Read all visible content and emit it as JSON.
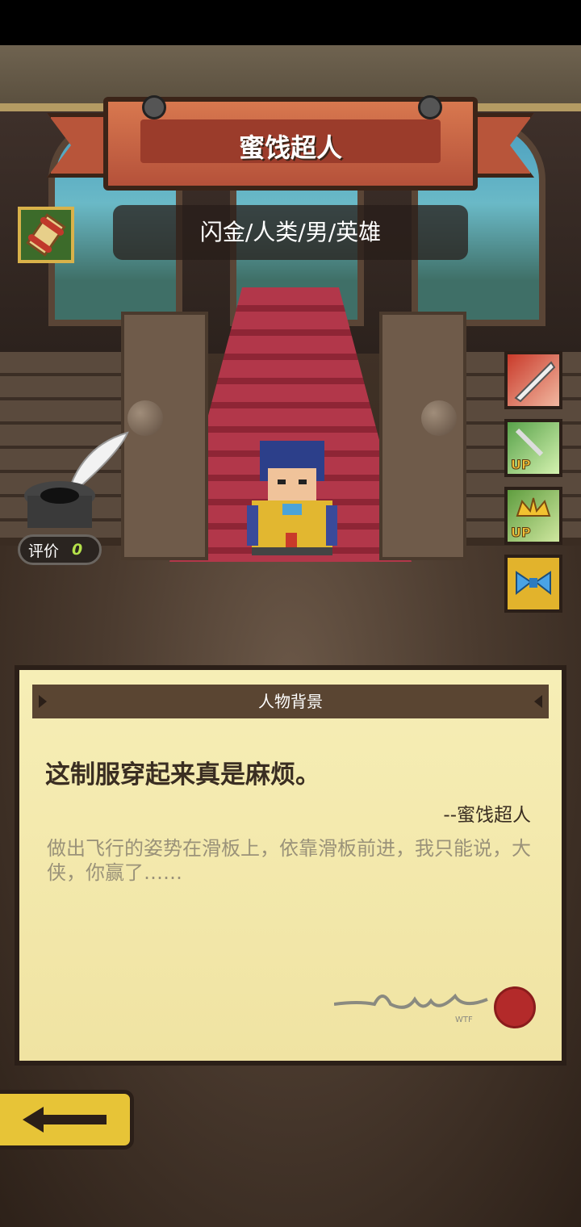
{
  "character": {
    "name": "蜜饯超人",
    "tags": "闪金/人类/男/英雄"
  },
  "rating": {
    "label": "评价",
    "value": "0"
  },
  "background_panel": {
    "header": "人物背景",
    "quote": "这制服穿起来真是麻烦。",
    "quote_author": "--蜜饯超人",
    "description": "做出飞行的姿势在滑板上，依靠滑板前进，我只能说，大侠，你赢了……"
  },
  "skills": [
    {
      "icon": "slash-skill-icon"
    },
    {
      "icon": "sword-up-skill-icon",
      "badge": "UP"
    },
    {
      "icon": "crown-up-skill-icon",
      "badge": "UP"
    },
    {
      "icon": "bowtie-item-icon"
    }
  ],
  "colors": {
    "banner": "#c4613f",
    "paper": "#f5ecb1",
    "back_button": "#e7c437",
    "rating_value": "#b4e14a"
  }
}
